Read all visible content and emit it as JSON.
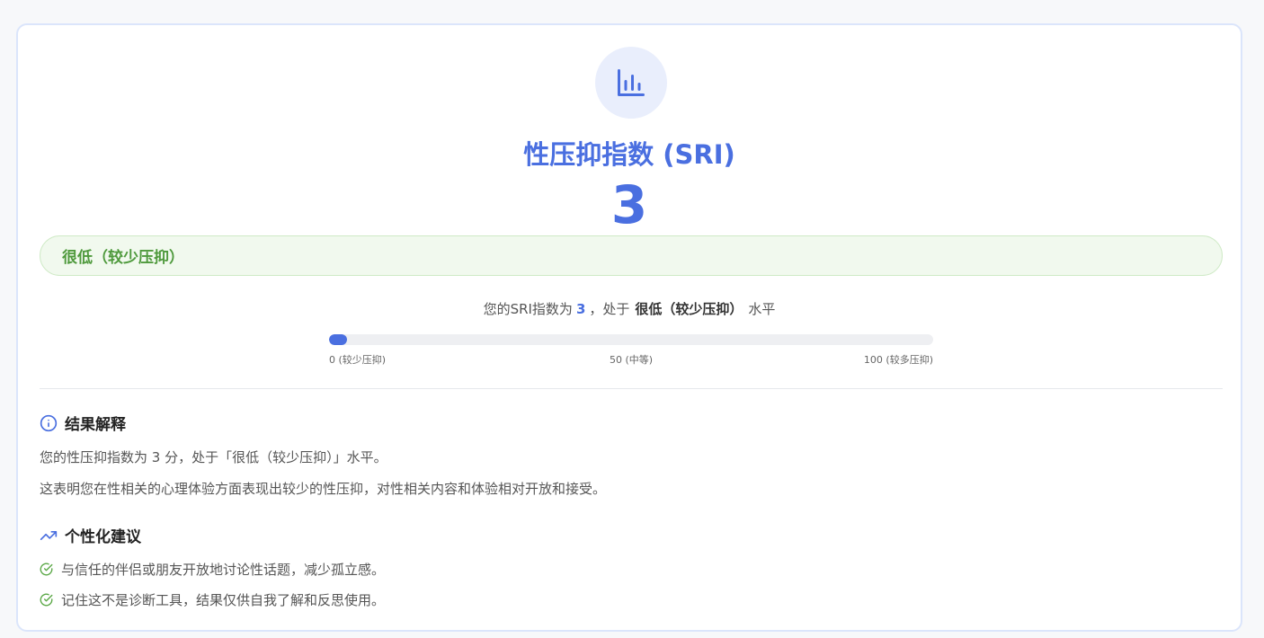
{
  "result": {
    "title": "性压抑指数 (SRI)",
    "score": "3",
    "level": "很低（较少压抑）",
    "summary_prefix": "您的SRI指数为",
    "summary_score": "3",
    "summary_mid": "，处于",
    "summary_level": "很低（较少压抑）",
    "summary_suffix": "水平",
    "progress_fraction": 0.03,
    "scale": {
      "min_label": "0 (较少压抑)",
      "mid_label": "50 (中等)",
      "max_label": "100 (较多压抑)"
    }
  },
  "interpretation": {
    "heading": "结果解释",
    "paragraphs": [
      "您的性压抑指数为 3 分，处于「很低（较少压抑）」水平。",
      "这表明您在性相关的心理体验方面表现出较少的性压抑，对性相关内容和体验相对开放和接受。"
    ]
  },
  "suggestions": {
    "heading": "个性化建议",
    "items": [
      "与信任的伴侣或朋友开放地讨论性话题，减少孤立感。",
      "记住这不是诊断工具，结果仅供自我了解和反思使用。"
    ]
  },
  "colors": {
    "accent": "#4a6fe0",
    "level_text": "#4f9a3d",
    "level_bg": "#f1f9ee",
    "check": "#5aa846"
  },
  "icons": {
    "header": "bar-chart-icon",
    "interpretation": "info-icon",
    "suggestions": "trending-up-icon",
    "suggestion_item": "check-circle-icon"
  }
}
